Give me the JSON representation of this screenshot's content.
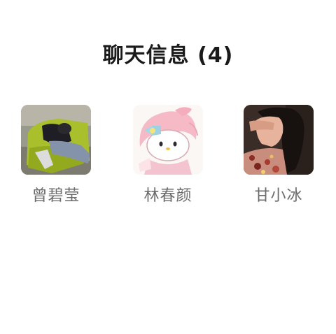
{
  "header": {
    "title": "聊天信息 (4)"
  },
  "members": [
    {
      "name": "曾碧莹",
      "avatar_icon": "person-on-green-chair-photo"
    },
    {
      "name": "林春颜",
      "avatar_icon": "my-melody-character"
    },
    {
      "name": "甘小冰",
      "avatar_icon": "woman-portrait-photo"
    }
  ],
  "colors": {
    "title": "#1a1a1a",
    "name": "#6b6b6b",
    "background": "#ffffff"
  }
}
